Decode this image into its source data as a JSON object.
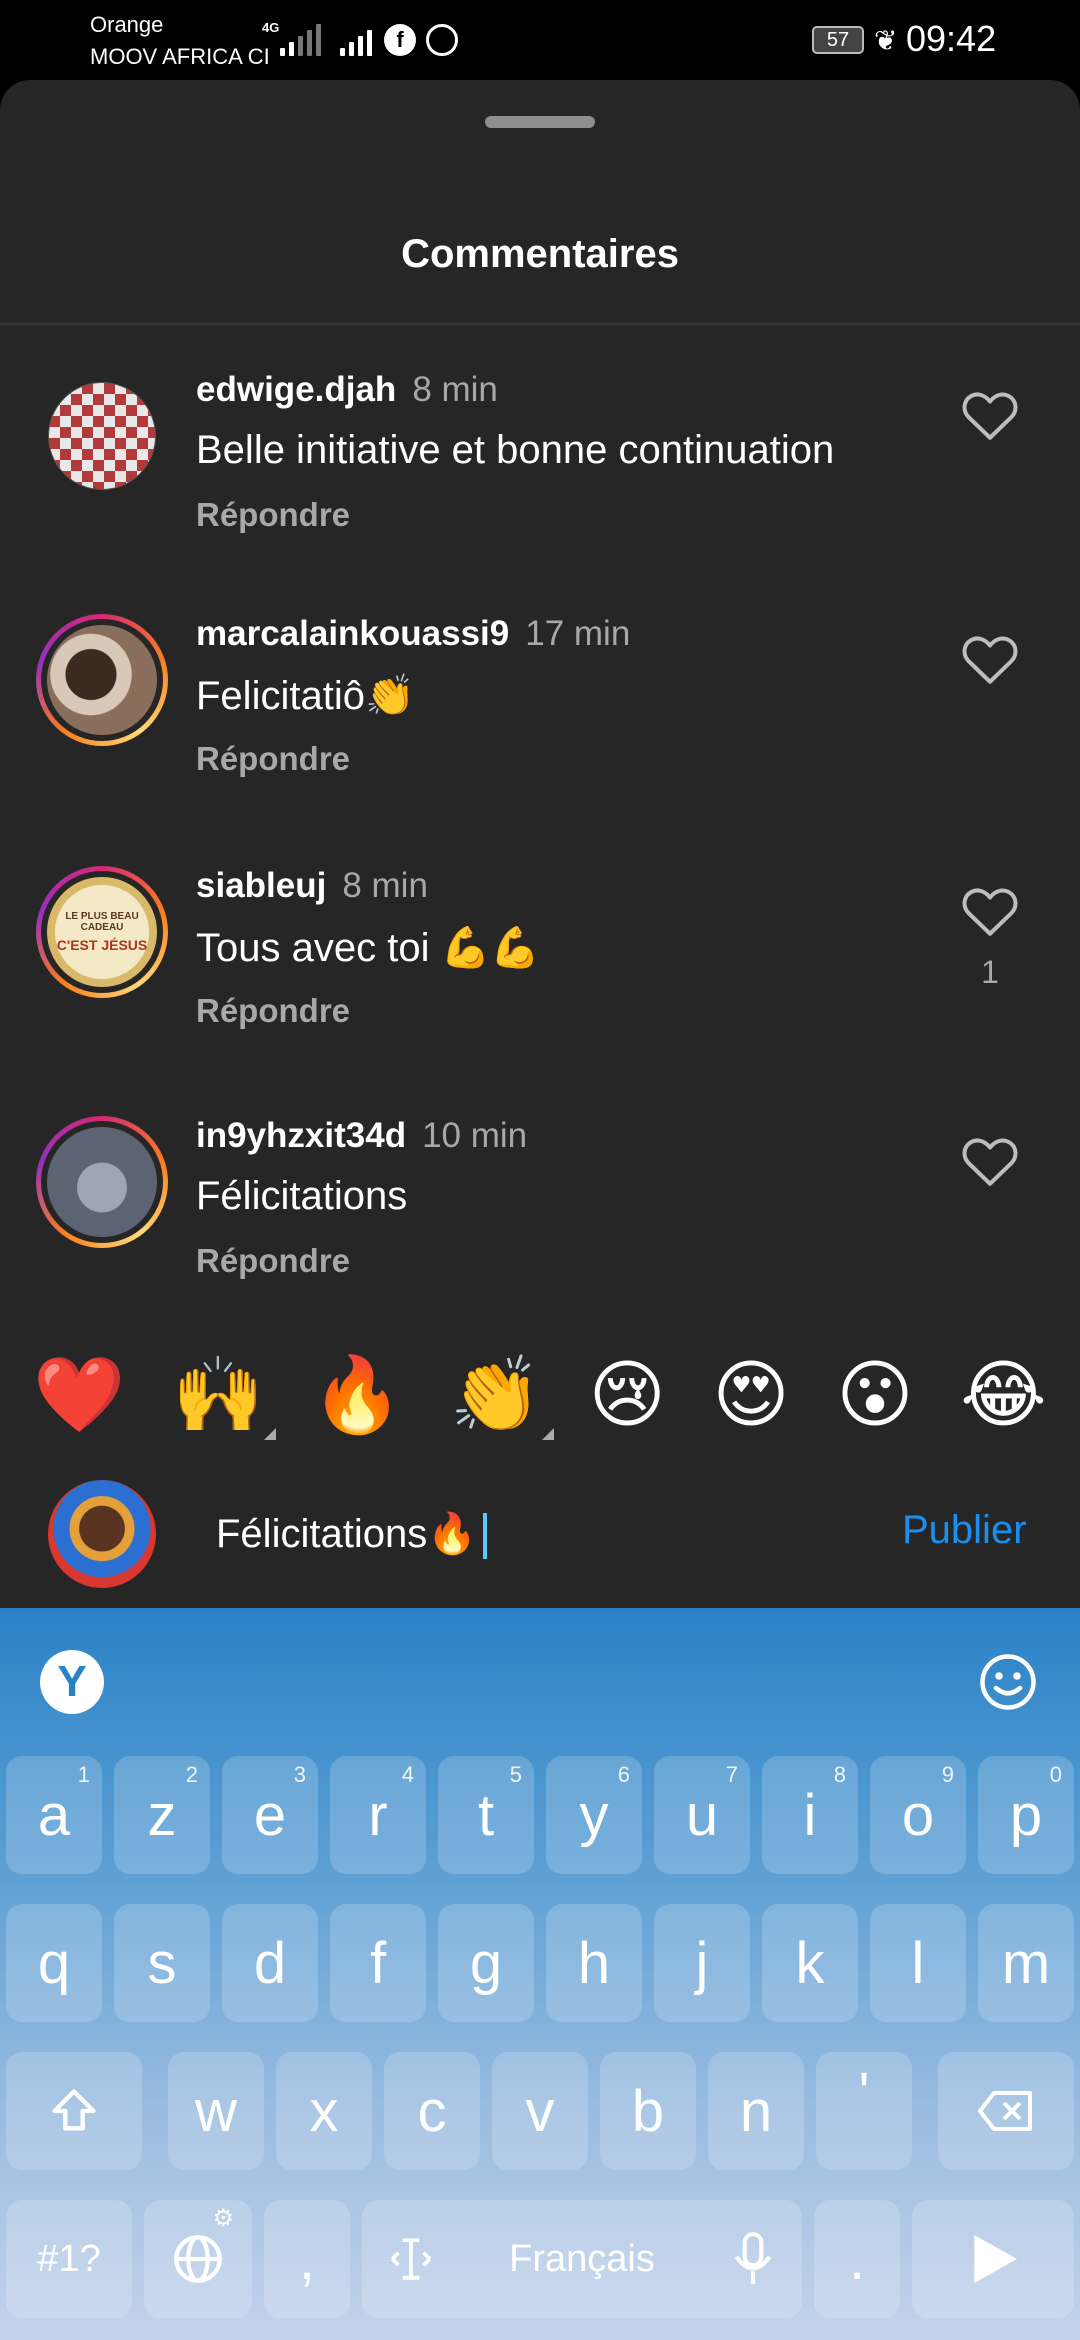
{
  "status_bar": {
    "carrier_line1": "Orange",
    "carrier_line2": "MOOV AFRICA CI",
    "network": "4G",
    "battery": "57",
    "time": "09:42"
  },
  "sheet": {
    "title": "Commentaires"
  },
  "comments": [
    {
      "username": "edwige.djah",
      "time": "8 min",
      "text": "Belle initiative et bonne continuation",
      "reply": "Répondre",
      "likes": ""
    },
    {
      "username": "marcalainkouassi9",
      "time": "17 min",
      "text": "Felicitatiô👏",
      "reply": "Répondre",
      "likes": ""
    },
    {
      "username": "siableuj",
      "time": "8 min",
      "text": "Tous avec toi 💪💪",
      "reply": "Répondre",
      "likes": "1"
    },
    {
      "username": "in9yhzxit34d",
      "time": "10 min",
      "text": "Félicitations",
      "reply": "Répondre",
      "likes": ""
    }
  ],
  "avatar_text": {
    "line1": "LE PLUS BEAU CADEAU",
    "line2": "C'EST JÉSUS"
  },
  "emoji_bar": [
    "❤️",
    "🙌",
    "🔥",
    "👏",
    "😢",
    "😍",
    "😮",
    "😂"
  ],
  "composer": {
    "value": "Félicitations🔥",
    "publish_label": "Publier"
  },
  "keyboard": {
    "logo": "Y",
    "row1": [
      {
        "k": "a",
        "n": "1"
      },
      {
        "k": "z",
        "n": "2"
      },
      {
        "k": "e",
        "n": "3"
      },
      {
        "k": "r",
        "n": "4"
      },
      {
        "k": "t",
        "n": "5"
      },
      {
        "k": "y",
        "n": "6"
      },
      {
        "k": "u",
        "n": "7"
      },
      {
        "k": "i",
        "n": "8"
      },
      {
        "k": "o",
        "n": "9"
      },
      {
        "k": "p",
        "n": "0"
      }
    ],
    "row2": [
      "q",
      "s",
      "d",
      "f",
      "g",
      "h",
      "j",
      "k",
      "l",
      "m"
    ],
    "row3": [
      "w",
      "x",
      "c",
      "v",
      "b",
      "n",
      "'"
    ],
    "symbols_label": "#1?",
    "comma": ",",
    "space_label": "Français",
    "period": "."
  },
  "colors": {
    "sheet_bg": "#262626",
    "accent_blue": "#1a8ff0",
    "secondary_text": "#a8a8a8"
  }
}
